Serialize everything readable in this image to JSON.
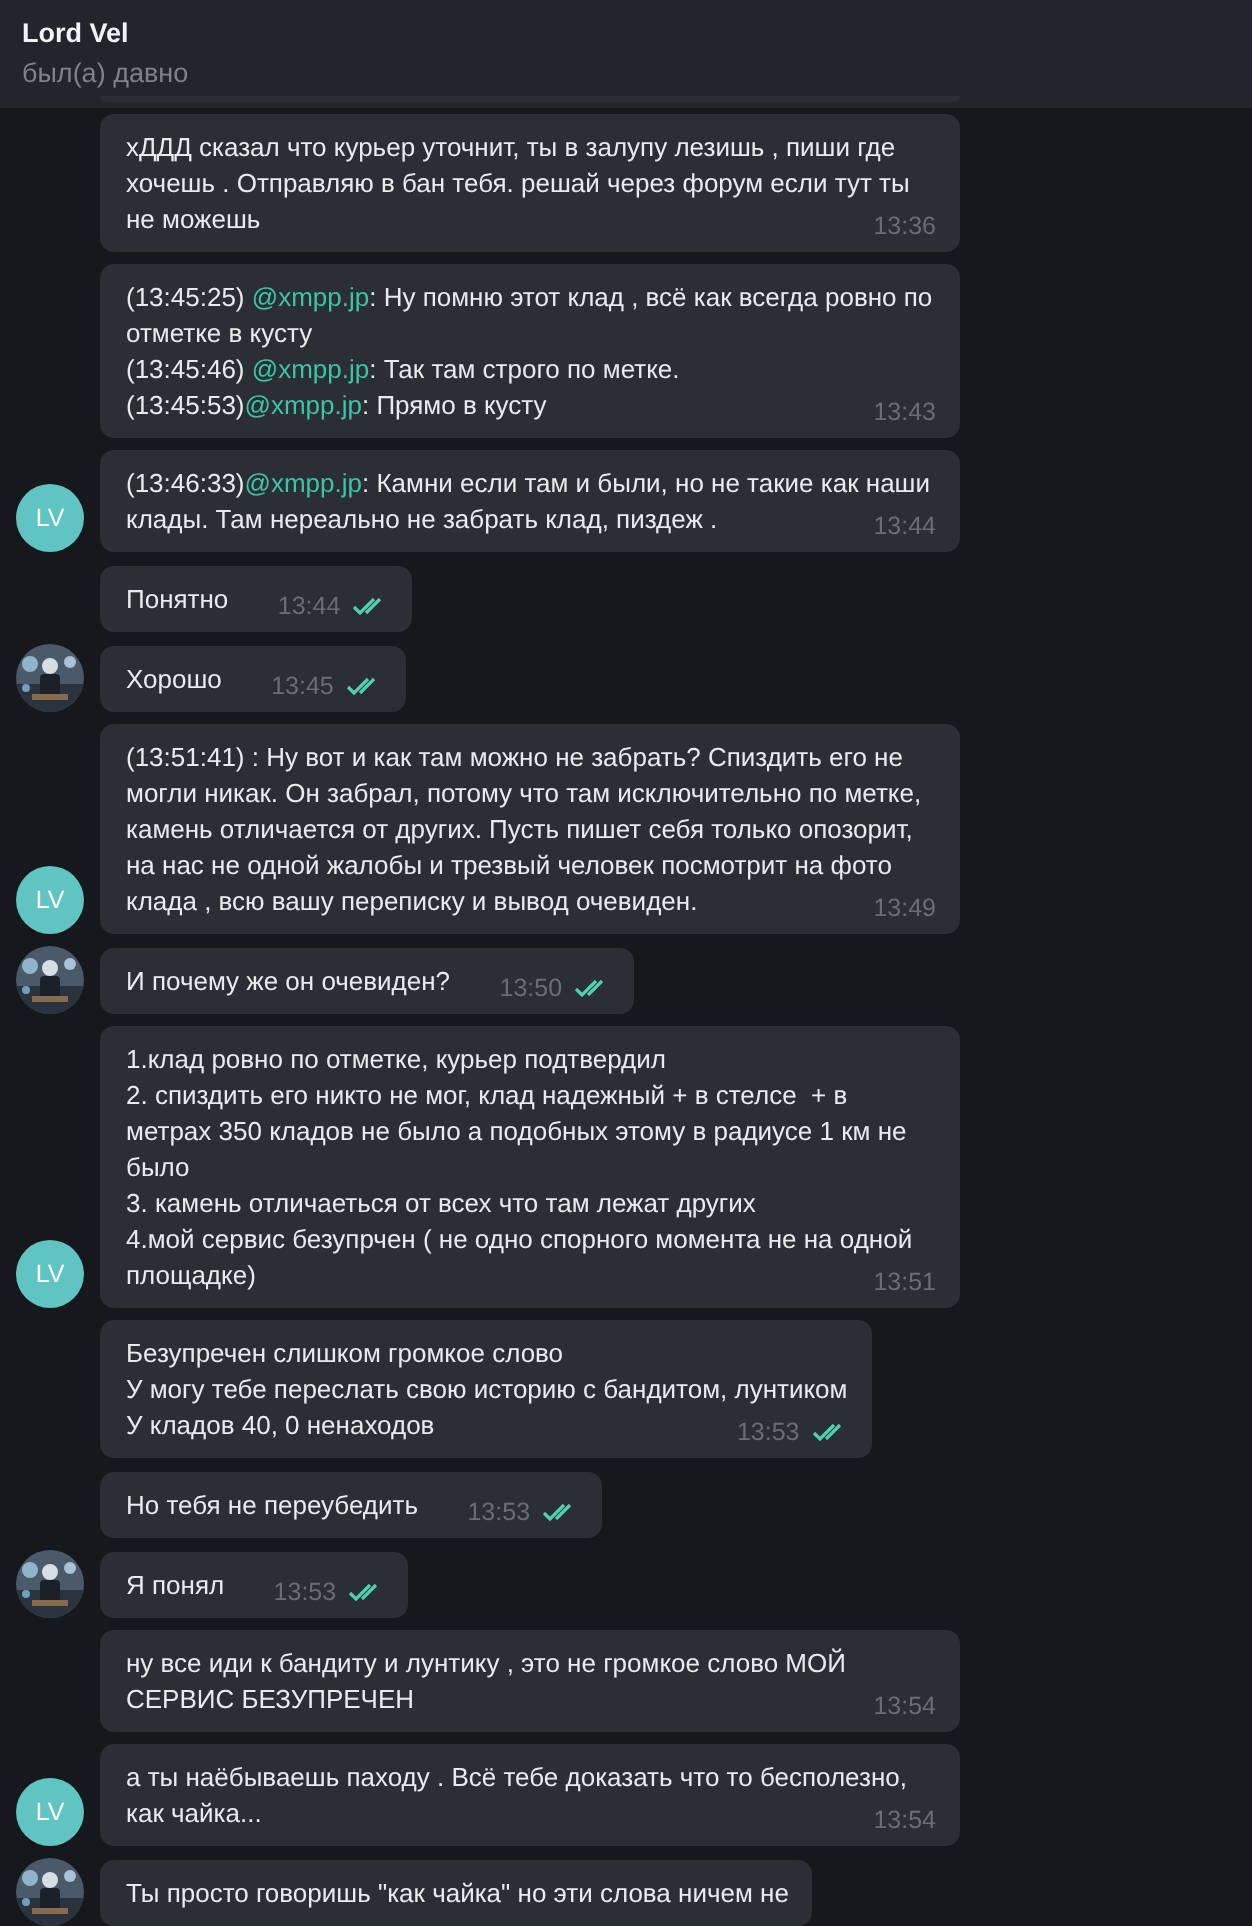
{
  "header": {
    "title": "Lord Vel",
    "status": "был(а) давно"
  },
  "messages": [
    {
      "parts": [
        {
          "kind": "plain",
          "text": "хДДД сказал что курьер уточнит, ты в залупу лезишь , пиши где хочешь . Отправляю в бан тебя. решай через форум если тут ты не можешь"
        }
      ],
      "time": "13:36"
    },
    {
      "parts": [
        {
          "kind": "plain",
          "text": "(13:45:25) "
        },
        {
          "kind": "mention",
          "text": "@xmpp.jp"
        },
        {
          "kind": "plain",
          "text": ": Ну помню этот клад , всё как всегда ровно по отметке в кусту\n(13:45:46) "
        },
        {
          "kind": "mention",
          "text": "@xmpp.jp"
        },
        {
          "kind": "plain",
          "text": ": Так там строго по метке.\n(13:45:53)"
        },
        {
          "kind": "mention",
          "text": "@xmpp.jp"
        },
        {
          "kind": "plain",
          "text": ": Прямо в кусту"
        }
      ],
      "time": "13:43"
    },
    {
      "parts": [
        {
          "kind": "plain",
          "text": "(13:46:33)"
        },
        {
          "kind": "mention",
          "text": "@xmpp.jp"
        },
        {
          "kind": "plain",
          "text": ": Камни если там и были, но не такие как наши клады. Там нереально не забрать клад, пиздеж ."
        }
      ],
      "time": "13:44",
      "avatar": {
        "kind": "initials",
        "text": "LV"
      }
    },
    {
      "read": true,
      "parts": [
        {
          "kind": "plain",
          "text": "Понятно"
        }
      ],
      "time": "13:44"
    },
    {
      "read": true,
      "parts": [
        {
          "kind": "plain",
          "text": "Хорошо"
        }
      ],
      "time": "13:45"
    },
    {
      "parts": [
        {
          "kind": "plain",
          "text": "(13:51:41) : Ну вот и как там можно не забрать? Спиздить его не могли никак. Он забрал, потому что там исключительно по метке, камень отличается от других. Пусть пишет себя только опозорит, на нас не одной жалобы и трезвый человек посмотрит на фото клада , всю вашу переписку и вывод очевиден."
        }
      ],
      "time": "13:49",
      "avatar": {
        "kind": "initials",
        "text": "LV"
      }
    },
    {
      "read": true,
      "parts": [
        {
          "kind": "plain",
          "text": "И почему же он очевиден?"
        }
      ],
      "time": "13:50"
    },
    {
      "parts": [
        {
          "kind": "plain",
          "text": "1.клад ровно по отметке, курьер подтвердил\n2. спиздить его никто не мог, клад надежный + в стелсе  + в метрах 350 кладов не было а подобных этому в радиусе 1 км не было\n3. камень отличаеться от всех что там лежат других\n4.мой сервис безупрчен ( не одно спорного момента не на одной площадке)"
        }
      ],
      "time": "13:51",
      "avatar": {
        "kind": "initials",
        "text": "LV"
      }
    },
    {
      "read": true,
      "parts": [
        {
          "kind": "plain",
          "text": "Безупречен слишком громкое слово\nУ могу тебе переслать свою историю с бандитом, лунтиком\nУ кладов 40, 0 ненаходов"
        }
      ],
      "time": "13:53"
    },
    {
      "read": true,
      "parts": [
        {
          "kind": "plain",
          "text": "Но тебя не переубедить"
        }
      ],
      "time": "13:53"
    },
    {
      "read": true,
      "parts": [
        {
          "kind": "plain",
          "text": "Я понял"
        }
      ],
      "time": "13:53"
    },
    {
      "parts": [
        {
          "kind": "plain",
          "text": "ну все иди к бандиту и лунтику , это не громкое слово МОЙ СЕРВИС БЕЗУПРЕЧЕН"
        }
      ],
      "time": "13:54"
    },
    {
      "parts": [
        {
          "kind": "plain",
          "text": "а ты наёбываешь паходу . Всё тебе доказать что то бесполезно, как чайка..."
        }
      ],
      "time": "13:54",
      "avatar": {
        "kind": "initials",
        "text": "LV"
      }
    },
    {
      "parts": [
        {
          "kind": "plain",
          "text": "Ты просто говоришь \"как чайка\" но эти слова ничем не"
        }
      ]
    }
  ]
}
